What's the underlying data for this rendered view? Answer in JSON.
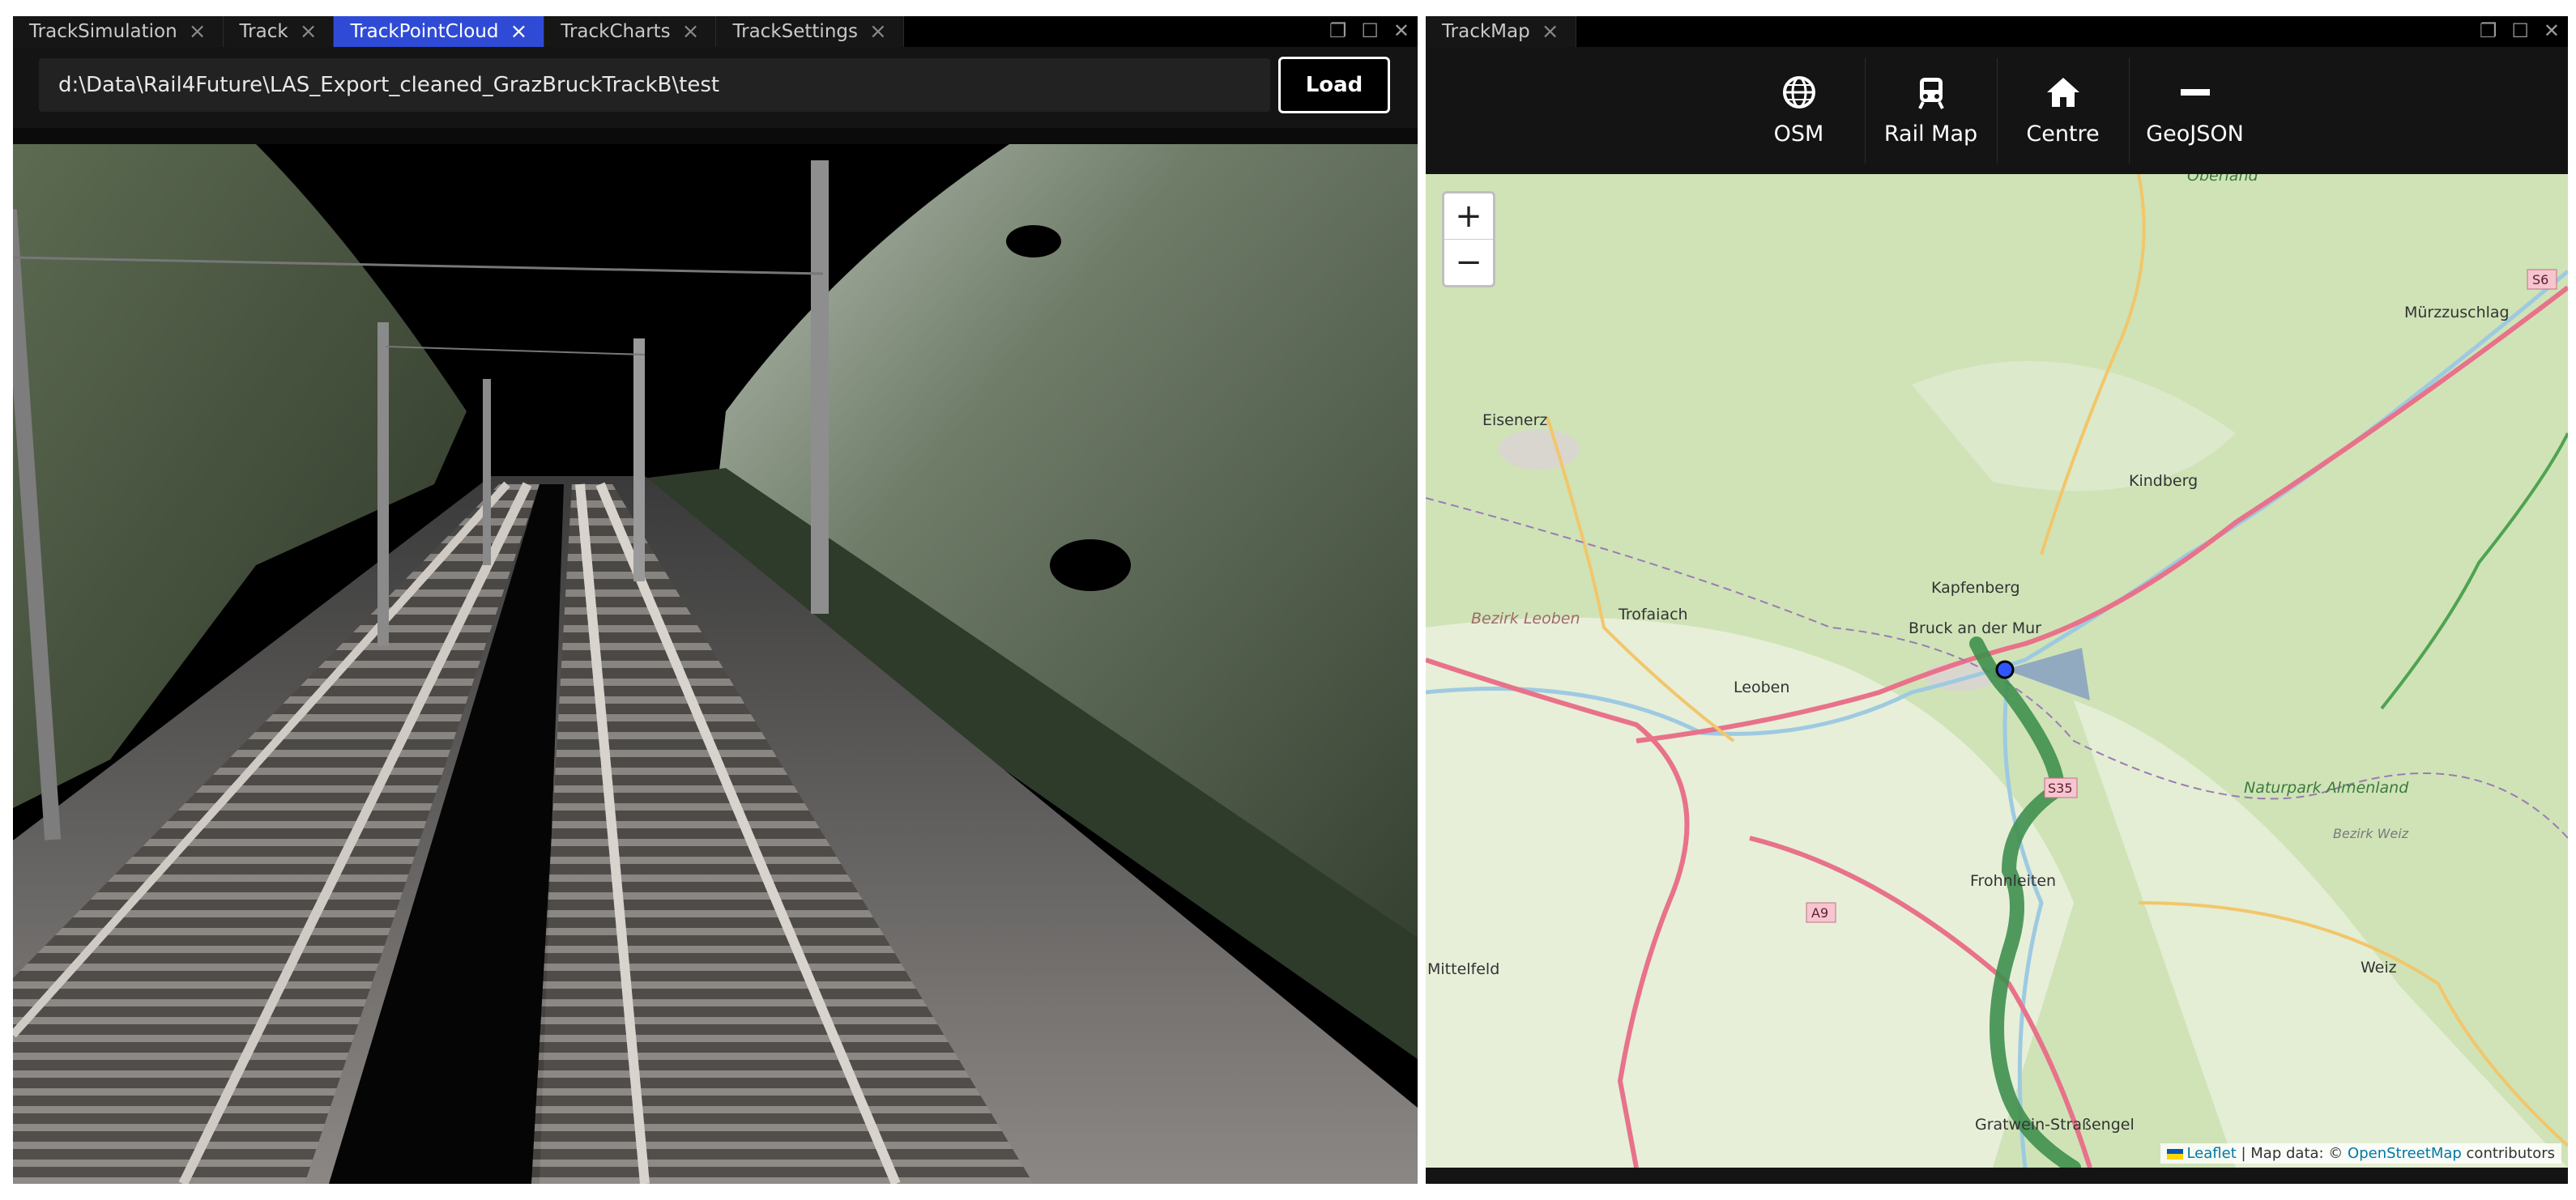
{
  "left_panel": {
    "tabs": [
      {
        "label": "TrackSimulation",
        "active": false
      },
      {
        "label": "Track",
        "active": false
      },
      {
        "label": "TrackPointCloud",
        "active": true
      },
      {
        "label": "TrackCharts",
        "active": false
      },
      {
        "label": "TrackSettings",
        "active": false
      }
    ],
    "path_value": "d:\\Data\\Rail4Future\\LAS_Export_cleaned_GrazBruckTrackB\\test",
    "load_label": "Load",
    "window_controls": [
      "restore-icon",
      "maximize-icon",
      "close-icon"
    ]
  },
  "right_panel": {
    "tab": {
      "label": "TrackMap",
      "active": false
    },
    "toolbar": [
      {
        "label": "OSM",
        "icon": "globe-icon"
      },
      {
        "label": "Rail Map",
        "icon": "train-icon"
      },
      {
        "label": "Centre",
        "icon": "home-icon"
      },
      {
        "label": "GeoJSON",
        "icon": "minus-icon"
      }
    ],
    "zoom_in": "+",
    "zoom_out": "−",
    "map_labels": [
      "Eisenerz",
      "Trofaiach",
      "Leoben",
      "Bezirk Leoben",
      "Kapfenberg",
      "Bruck an der Mur",
      "Kindberg",
      "Mürzzuschlag",
      "Frohnleiten",
      "Naturpark Almenland",
      "Bezirk Weiz",
      "Weiz",
      "Gratwein-Straßengel",
      "Mittelfeld",
      "Oberland",
      "A9",
      "S6",
      "S35"
    ],
    "attribution": {
      "leaflet": "Leaflet",
      "text": " | Map data: © ",
      "osm": "OpenStreetMap",
      "suffix": " contributors"
    },
    "window_controls": [
      "restore-icon",
      "maximize-icon",
      "close-icon"
    ]
  },
  "colors": {
    "active_tab": "#2f4bd6",
    "track_route": "#3f8f4e",
    "map_land": "#cfe3b7",
    "motorway": "#e8728a",
    "position_marker": "#1f3fd0"
  }
}
